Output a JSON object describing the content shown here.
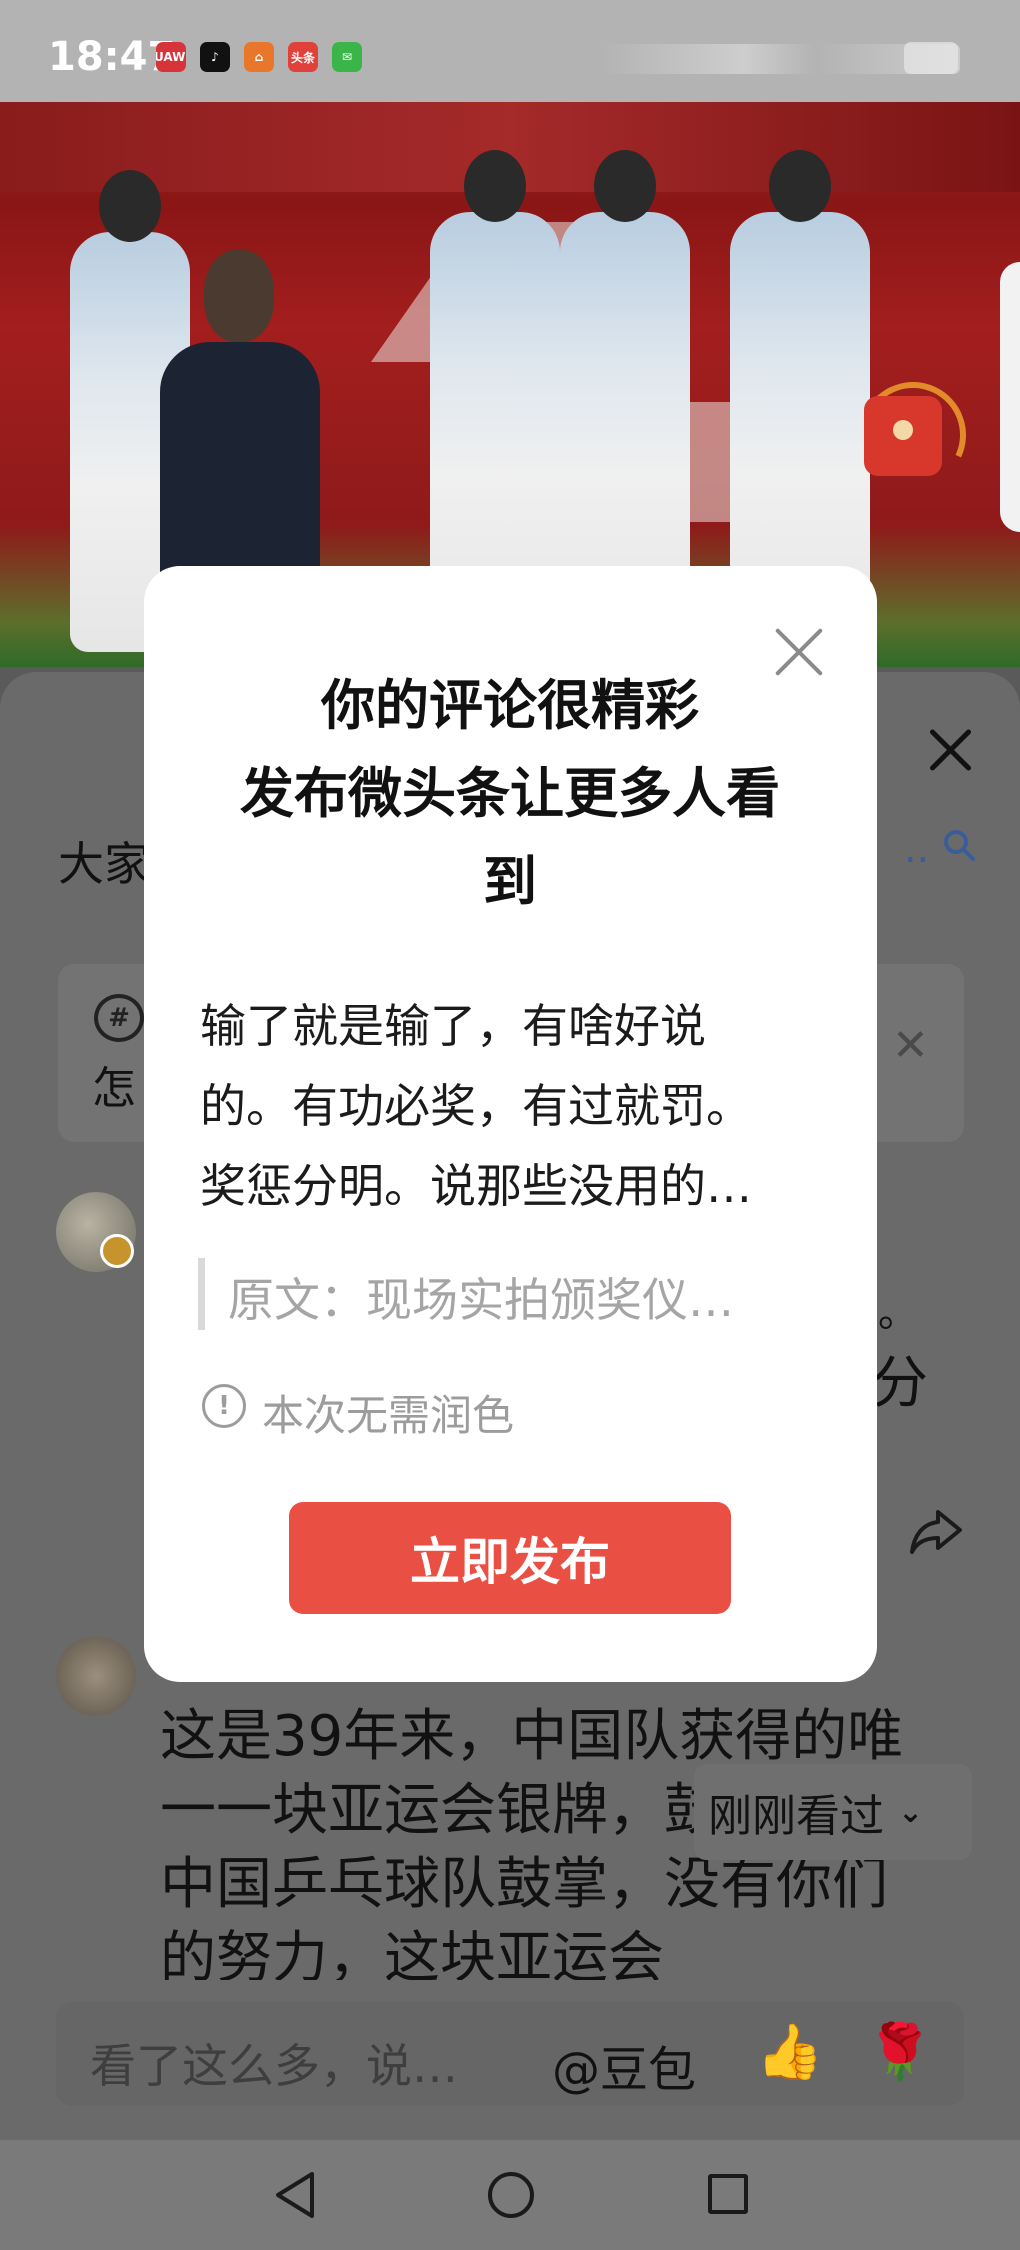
{
  "status_bar": {
    "time": "18:47",
    "apps": [
      {
        "name": "huawei-app-icon",
        "color": "#d6343a",
        "label": "HUAWEI"
      },
      {
        "name": "tiktok-icon",
        "color": "#111111",
        "label": "♪"
      },
      {
        "name": "app-orange-icon",
        "color": "#e8772c",
        "label": "⌂"
      },
      {
        "name": "toutiao-icon",
        "color": "#e0413b",
        "label": "头条"
      },
      {
        "name": "wechat-icon",
        "color": "#3bb54a",
        "label": "✉"
      }
    ]
  },
  "background_page": {
    "heading": "大家",
    "search_suffix": "..",
    "topic_text": "怎",
    "fragment_dot": "。",
    "fragment_fen": "分",
    "comment2": "这是39年来，中国队获得的唯一一块亚运会银牌，鼓掌，为中国乒乓球队鼓掌，没有你们的努力，这块亚运会",
    "recent_chip": "刚刚看过",
    "input_placeholder": "看了这么多，说…",
    "input_mention": "@豆包"
  },
  "modal": {
    "title_lines": [
      "你的评论很精彩",
      "发布微头条让更多人看",
      "到"
    ],
    "comment_lines": [
      "输了就是输了，有啥好说",
      "的。有功必奖，有过就罚。",
      "奖惩分明。说那些没用的…"
    ],
    "quote": "原文：现场实拍颁奖仪…",
    "info": "本次无需润色",
    "info_icon": "!",
    "publish_label": "立即发布"
  },
  "colors": {
    "accent": "#ea4f44",
    "overlay": "#5a5a5a"
  }
}
